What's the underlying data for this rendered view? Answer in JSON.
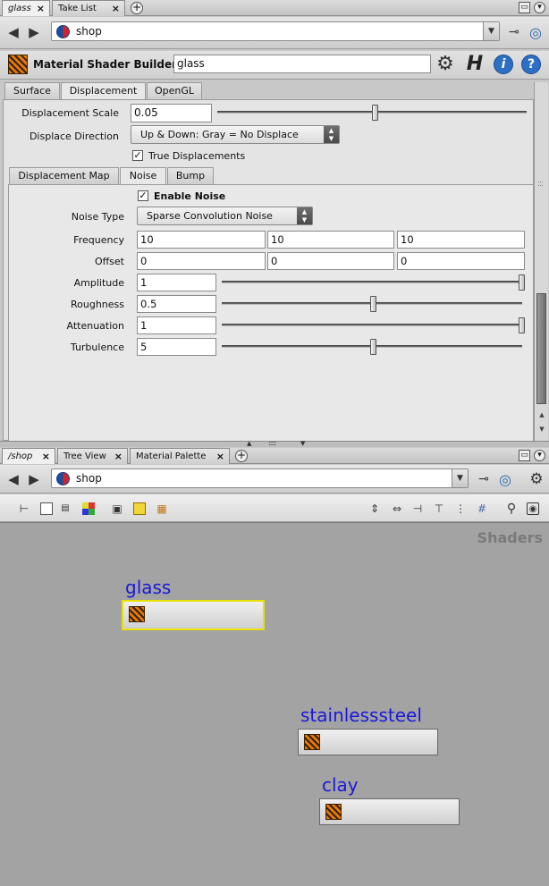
{
  "top_pane": {
    "tabs": [
      {
        "label": "glass",
        "active": true
      },
      {
        "label": "Take List"
      }
    ],
    "path": "shop",
    "node_type": "Material Shader Builder",
    "node_name": "glass",
    "param_tabs": [
      "Surface",
      "Displacement",
      "OpenGL"
    ],
    "active_param_tab": "Displacement",
    "params": {
      "displacement_scale": {
        "label": "Displacement Scale",
        "value": "0.05",
        "slider": 0.51
      },
      "displace_direction": {
        "label": "Displace Direction",
        "value": "Up & Down: Gray = No Displace"
      },
      "true_displacements": {
        "label": "True Displacements",
        "checked": true
      }
    },
    "sub_tabs": [
      "Displacement Map",
      "Noise",
      "Bump"
    ],
    "active_sub_tab": "Noise",
    "noise": {
      "enable_noise": {
        "label": "Enable Noise",
        "checked": true
      },
      "noise_type": {
        "label": "Noise Type",
        "value": "Sparse Convolution Noise"
      },
      "frequency": {
        "label": "Frequency",
        "values": [
          "10",
          "10",
          "10"
        ]
      },
      "offset": {
        "label": "Offset",
        "values": [
          "0",
          "0",
          "0"
        ]
      },
      "amplitude": {
        "label": "Amplitude",
        "value": "1",
        "slider": 1.0
      },
      "roughness": {
        "label": "Roughness",
        "value": "0.5",
        "slider": 0.5
      },
      "attenuation": {
        "label": "Attenuation",
        "value": "1",
        "slider": 1.0
      },
      "turbulence": {
        "label": "Turbulence",
        "value": "5",
        "slider": 0.5
      }
    }
  },
  "bottom_pane": {
    "tabs": [
      {
        "label": "/shop",
        "active": true
      },
      {
        "label": "Tree View"
      },
      {
        "label": "Material Palette"
      }
    ],
    "path": "shop",
    "context_label": "Shaders",
    "nodes": [
      {
        "name": "glass",
        "selected": true
      },
      {
        "name": "stainlesssteel",
        "selected": false
      },
      {
        "name": "clay",
        "selected": false
      }
    ]
  },
  "colors": {
    "node_name": "#1a18d8",
    "selection": "#e8e000",
    "network_bg": "#a3a3a3"
  }
}
